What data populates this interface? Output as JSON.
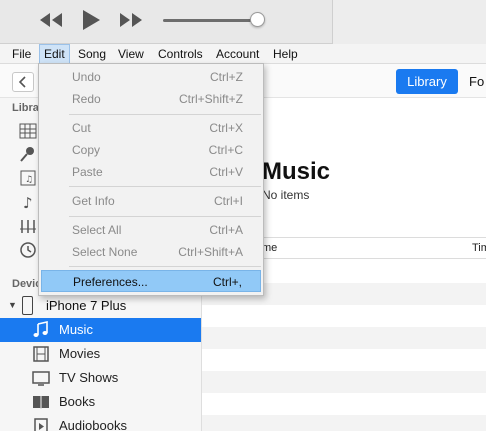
{
  "menubar": {
    "items": [
      "File",
      "Edit",
      "Song",
      "View",
      "Controls",
      "Account",
      "Help"
    ],
    "active": "Edit"
  },
  "toolbar": {
    "back_icon": "chevron-left-icon",
    "library_label": "Library",
    "next_tab_label": "Fo"
  },
  "edit_menu": {
    "items": [
      {
        "label": "Undo",
        "shortcut": "Ctrl+Z"
      },
      {
        "label": "Redo",
        "shortcut": "Ctrl+Shift+Z"
      },
      {
        "label": "Cut",
        "shortcut": "Ctrl+X"
      },
      {
        "label": "Copy",
        "shortcut": "Ctrl+C"
      },
      {
        "label": "Paste",
        "shortcut": "Ctrl+V"
      },
      {
        "label": "Get Info",
        "shortcut": "Ctrl+I"
      },
      {
        "label": "Select All",
        "shortcut": "Ctrl+A"
      },
      {
        "label": "Select None",
        "shortcut": "Ctrl+Shift+A"
      },
      {
        "label": "Preferences...",
        "shortcut": "Ctrl+,"
      }
    ],
    "highlighted": "Preferences..."
  },
  "sidebar": {
    "library_heading": "Librar",
    "devices_heading": "Devic",
    "device_name": "iPhone 7 Plus",
    "device_items": [
      {
        "label": "Music",
        "icon": "music-note-icon",
        "selected": true
      },
      {
        "label": "Movies",
        "icon": "film-icon",
        "selected": false
      },
      {
        "label": "TV Shows",
        "icon": "tv-icon",
        "selected": false
      },
      {
        "label": "Books",
        "icon": "book-icon",
        "selected": false
      },
      {
        "label": "Audiobooks",
        "icon": "audiobook-icon",
        "selected": false
      }
    ]
  },
  "main": {
    "title": "Music",
    "subtitle": "No items",
    "col_name": "me",
    "col_time": "Tim"
  },
  "colors": {
    "accent": "#1a7af0",
    "menu_highlight": "#91c9f7"
  }
}
